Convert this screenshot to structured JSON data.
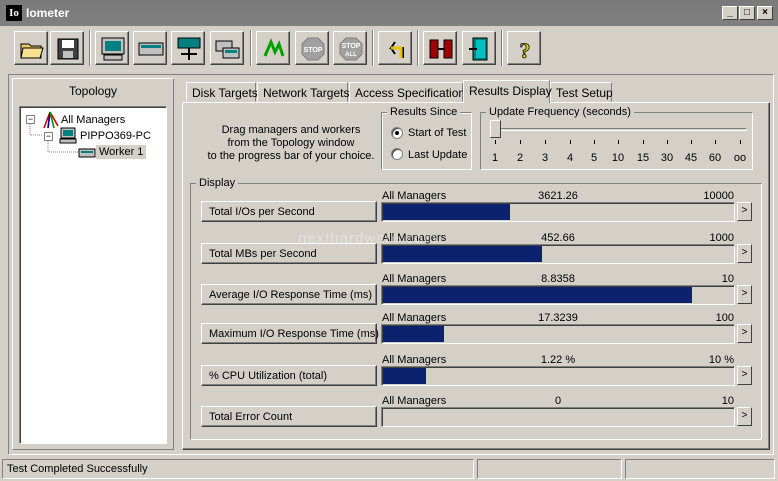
{
  "window": {
    "title": "Iometer",
    "icon_text": "Io"
  },
  "toolbar": {
    "items": [
      "open-icon",
      "save-icon",
      "new-manager-icon",
      "new-disk-worker-icon",
      "new-network-worker-icon",
      "duplicate-worker-icon",
      "start-test-icon",
      "stop-icon",
      "stop-all-icon",
      "reset-workers-icon",
      "disconnect-icon",
      "exit-icon",
      "help-icon"
    ],
    "stop_label": "STOP",
    "stop_all_label": "STOP",
    "all_label": "ALL"
  },
  "topology": {
    "title": "Topology",
    "root": "All Managers",
    "manager": "PIPPO369-PC",
    "worker": "Worker 1"
  },
  "tabs": [
    "Disk Targets",
    "Network Targets",
    "Access Specifications",
    "Results Display",
    "Test Setup"
  ],
  "instructions": "Drag managers and workers\nfrom the Topology window\nto the progress bar of your choice.",
  "results_since": {
    "title": "Results Since",
    "options": [
      "Start of Test",
      "Last Update"
    ],
    "selected": "Start of Test"
  },
  "update_frequency": {
    "title": "Update Frequency (seconds)",
    "ticks": [
      "1",
      "2",
      "3",
      "4",
      "5",
      "10",
      "15",
      "30",
      "45",
      "60",
      "oo"
    ],
    "selected_index": 0
  },
  "display": {
    "title": "Display",
    "rows": [
      {
        "button": "Total I/Os per Second",
        "source": "All Managers",
        "value": "3621.26",
        "max": "10000",
        "fill": 0.362
      },
      {
        "button": "Total MBs per Second",
        "source": "All Managers",
        "value": "452.66",
        "max": "1000",
        "fill": 0.453
      },
      {
        "button": "Average I/O Response Time (ms)",
        "source": "All Managers",
        "value": "8.8358",
        "max": "10",
        "fill": 0.8836
      },
      {
        "button": "Maximum I/O Response Time (ms)",
        "source": "All Managers",
        "value": "17.3239",
        "max": "100",
        "fill": 0.173
      },
      {
        "button": "% CPU Utilization (total)",
        "source": "All Managers",
        "value": "1.22 %",
        "max": "10 %",
        "fill": 0.122
      },
      {
        "button": "Total Error Count",
        "source": "All Managers",
        "value": "0",
        "max": "10",
        "fill": 0
      }
    ],
    "arrow": ">"
  },
  "status_bar": {
    "text": "Test Completed Successfully"
  },
  "watermark": "nexthardware.com"
}
